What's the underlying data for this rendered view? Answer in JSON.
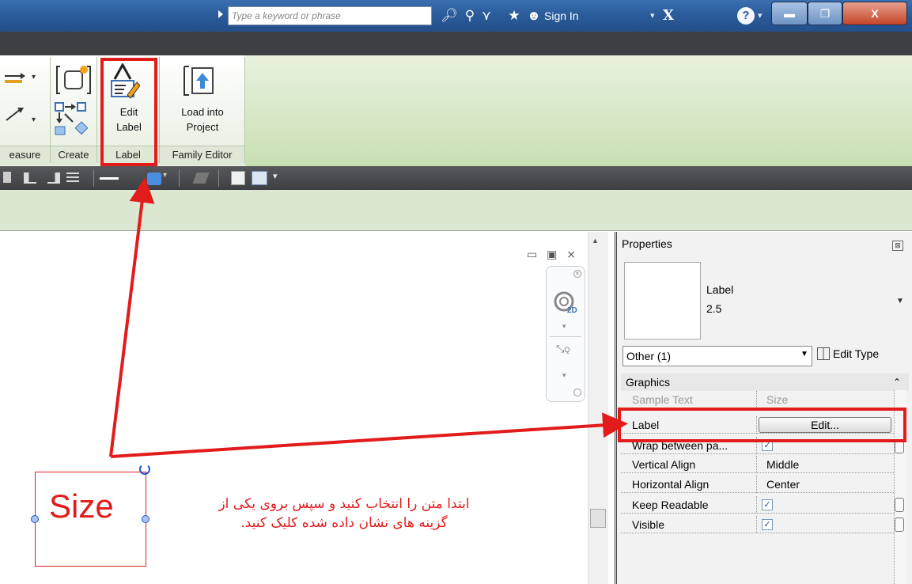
{
  "title_bar": {
    "search_placeholder": "Type a keyword or phrase",
    "sign_in": "Sign In",
    "help": "?",
    "minimize": "▬",
    "maximize": "❐",
    "close": "X"
  },
  "ribbon": {
    "measure_panel": "easure",
    "create_panel": "Create",
    "label_panel": "Label",
    "family_editor_panel": "Family Editor",
    "edit_label_line1": "Edit",
    "edit_label_line2": "Label",
    "load_into_line1": "Load into",
    "load_into_line2": "Project"
  },
  "properties": {
    "title": "Properties",
    "close": "⊠",
    "type_family": "Label",
    "type_name": "2.5",
    "filter": "Other (1)",
    "edit_type": "Edit Type",
    "section": "Graphics",
    "rows": [
      {
        "name": "Sample Text",
        "value": "Size"
      },
      {
        "name": "Label",
        "value": "Edit..."
      },
      {
        "name": "Wrap between pa...",
        "value": "✓"
      },
      {
        "name": "Vertical Align",
        "value": "Middle"
      },
      {
        "name": "Horizontal Align",
        "value": "Center"
      },
      {
        "name": "Keep Readable",
        "value": "✓"
      },
      {
        "name": "Visible",
        "value": "✓"
      }
    ]
  },
  "canvas": {
    "label_text": "Size",
    "instruction_line1": "ابتدا متن را انتخاب کنید و سپس بروی یکی از",
    "instruction_line2": "گزینه های نشان داده شده کلیک کنید."
  },
  "colors": {
    "highlight": "#e21b1b",
    "title_bar": "#2b5c9b",
    "ribbon_green": "#d7e8c6"
  }
}
